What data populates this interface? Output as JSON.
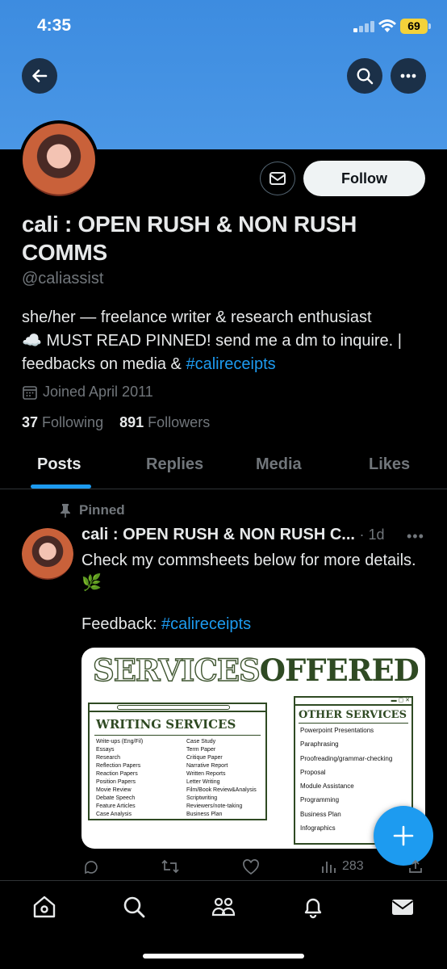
{
  "status": {
    "time": "4:35",
    "battery": "69"
  },
  "profile": {
    "name": "cali : OPEN RUSH & NON RUSH COMMS",
    "handle": "@caliassist",
    "follow_label": "Follow",
    "bio_line1": "she/her — freelance writer & research enthusiast",
    "bio_line2": "☁️ MUST READ PINNED! send me a dm to inquire. |",
    "bio_line3": "feedbacks on media & ",
    "bio_hashtag": "#calireceipts",
    "joined": "Joined April 2011",
    "following_count": "37",
    "following_label": "Following",
    "followers_count": "891",
    "followers_label": "Followers"
  },
  "tabs": [
    "Posts",
    "Replies",
    "Media",
    "Likes"
  ],
  "post": {
    "pinned_label": "Pinned",
    "author": "cali : OPEN RUSH & NON RUSH C...",
    "time": "· 1d",
    "text": "Check my commsheets below for more details. 🌿",
    "feedback_prefix": "Feedback: ",
    "feedback_hashtag": "#calireceipts",
    "views": "283",
    "media": {
      "title_outline": "SERVICES",
      "title_fill": "OFFERED",
      "writing_title": "WRITING SERVICES",
      "writing_col1": [
        "Write-ups (Eng/Fil)",
        "Essays",
        "Research",
        "Reflection Papers",
        "Reaction Papers",
        "Position Papers",
        "Movie Review",
        "Debate Speech",
        "Feature Articles",
        "Case Analysis"
      ],
      "writing_col2": [
        "Case Study",
        "Term Paper",
        "Critique Paper",
        "Narrative Report",
        "Written Reports",
        "Letter Writing",
        "Film/Book Review&Analysis",
        "Scriptwriting",
        "Reviewers/note-taking",
        "Business Plan"
      ],
      "other_title": "OTHER SERVICES",
      "other_list": [
        "Powerpoint Presentations",
        "Paraphrasing",
        "Proofreading/grammar-checking",
        "Proposal",
        "Module Assistance",
        "Programming",
        "Business Plan",
        "Infographics"
      ]
    }
  },
  "colors": {
    "accent": "#1d9bf0",
    "banner": "#4a97e6",
    "media_green": "#2f4a23"
  }
}
